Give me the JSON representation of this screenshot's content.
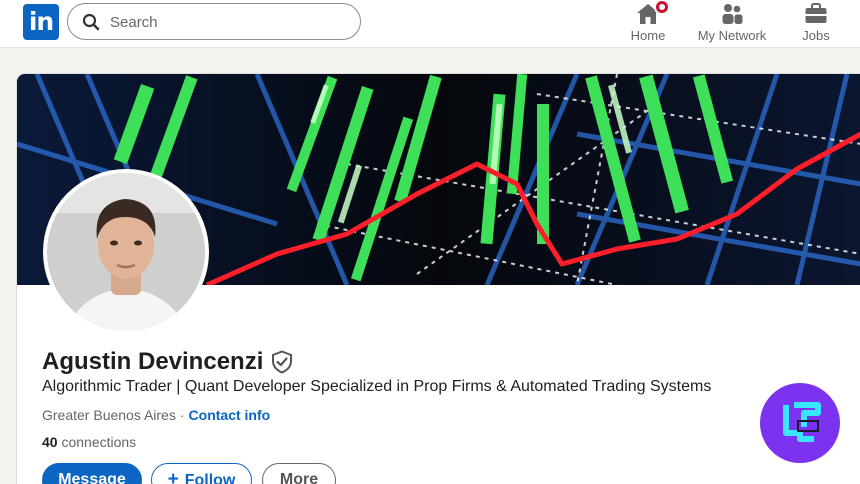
{
  "topnav": {
    "logo_text": "in",
    "search": {
      "placeholder": "Search"
    },
    "items": [
      {
        "label": "Home",
        "icon": "home-icon",
        "badge": "notification-dot"
      },
      {
        "label": "My Network",
        "icon": "my-network-icon"
      },
      {
        "label": "Jobs",
        "icon": "jobs-briefcase-icon"
      }
    ]
  },
  "profile": {
    "name": "Agustin Devincenzi",
    "verified_icon": "verified-shield-icon",
    "headline": "Algorithmic Trader | Quant Developer Specialized in Prop Firms & Automated Trading Systems",
    "location": "Greater Buenos Aires",
    "separator": "·",
    "contact_link": "Contact info",
    "connections_count": "40",
    "connections_label": "connections",
    "banner": "trading-chart-banner",
    "avatar": "profile-photo"
  },
  "actions": {
    "message": "Message",
    "follow_plus": "+",
    "follow": "Follow",
    "more": "More"
  },
  "watermark": {
    "icon": "tradingfinder-logo-icon",
    "color": "#7b33ef"
  },
  "colors": {
    "brand": "#0a66c2",
    "notification": "#cb112d",
    "background": "#f4f2ee"
  }
}
